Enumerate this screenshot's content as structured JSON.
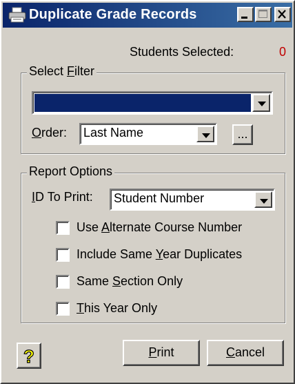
{
  "window": {
    "title": "Duplicate Grade Records",
    "title_icon": "printer-icon",
    "controls": [
      "minimize-icon",
      "maximize-icon",
      "close-icon"
    ]
  },
  "status": {
    "students_selected_label": "Students Selected:",
    "students_selected_value": "0"
  },
  "select_filter": {
    "legend_pre": "Select ",
    "legend_key": "F",
    "legend_post": "ilter",
    "filter_value": "",
    "order_label_key": "O",
    "order_label_post": "rder:",
    "order_value": "Last Name",
    "ellipsis_label": "..."
  },
  "report_options": {
    "legend": "Report Options",
    "id_label_key": "I",
    "id_label_post": "D To Print:",
    "id_value": "Student Number",
    "checkboxes": [
      {
        "pre": "Use ",
        "key": "A",
        "post": "lternate Course Number",
        "checked": false
      },
      {
        "pre": "Include Same ",
        "key": "Y",
        "post": "ear Duplicates",
        "checked": false
      },
      {
        "pre": "Same ",
        "key": "S",
        "post": "ection Only",
        "checked": false
      },
      {
        "pre": "",
        "key": "T",
        "post": "his Year Only",
        "checked": false
      }
    ]
  },
  "buttons": {
    "help_icon": "question-mark-icon",
    "print_key": "P",
    "print_post": "rint",
    "cancel_key": "C",
    "cancel_post": "ancel"
  },
  "colors": {
    "title_bar": "#0a246a",
    "selection": "#0a246a",
    "count": "#c00000",
    "help_glyph": "#ffff00"
  }
}
